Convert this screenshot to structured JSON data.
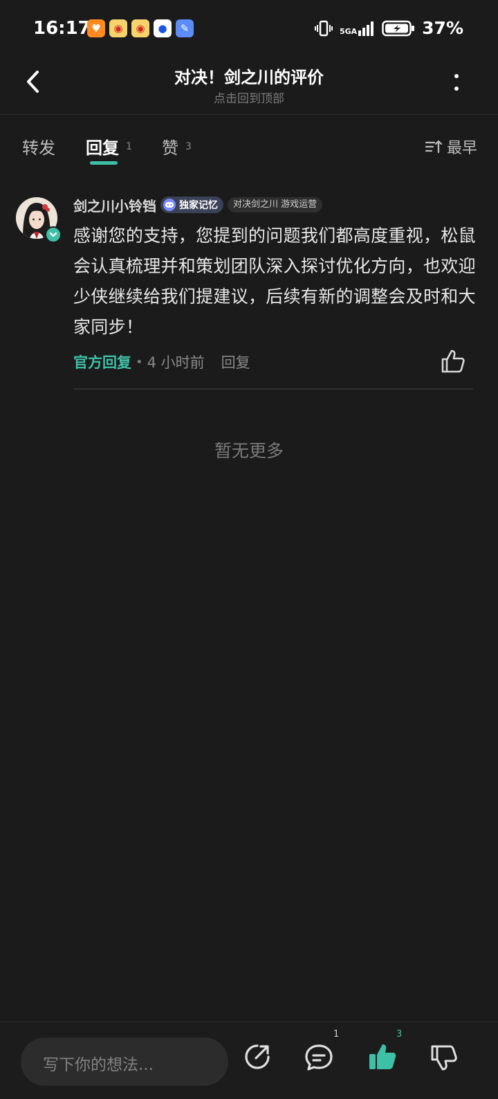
{
  "status_bar": {
    "time": "16:17",
    "network": "5GA",
    "battery": "37%",
    "app_icons": [
      "taobao-icon",
      "weibo-icon",
      "weibo-icon",
      "app-blue-icon",
      "app-blue-icon"
    ]
  },
  "header": {
    "title": "对决！剑之川的评价",
    "subtitle": "点击回到顶部"
  },
  "tabs": [
    {
      "label": "转发",
      "count": ""
    },
    {
      "label": "回复",
      "count": "1"
    },
    {
      "label": "赞",
      "count": "3"
    }
  ],
  "sort_label": "最早",
  "comment": {
    "user_name": "剑之川小铃铛",
    "badge": "独家记忆",
    "role_tag": "对决剑之川 游戏运营",
    "text": "感谢您的支持，您提到的问题我们都高度重视，松鼠会认真梳理并和策划团队深入探讨优化方向，也欢迎少侠继续给我们提建议，后续有新的调整会及时和大家同步！",
    "official_label": "官方回复",
    "time": "4 小时前",
    "reply_label": "回复"
  },
  "no_more": "暂无更多",
  "bottom_bar": {
    "input_placeholder": "写下你的想法...",
    "comment_count": "1",
    "like_count": "3"
  },
  "colors": {
    "accent": "#3ec0a7",
    "background": "#1b1b1b"
  }
}
